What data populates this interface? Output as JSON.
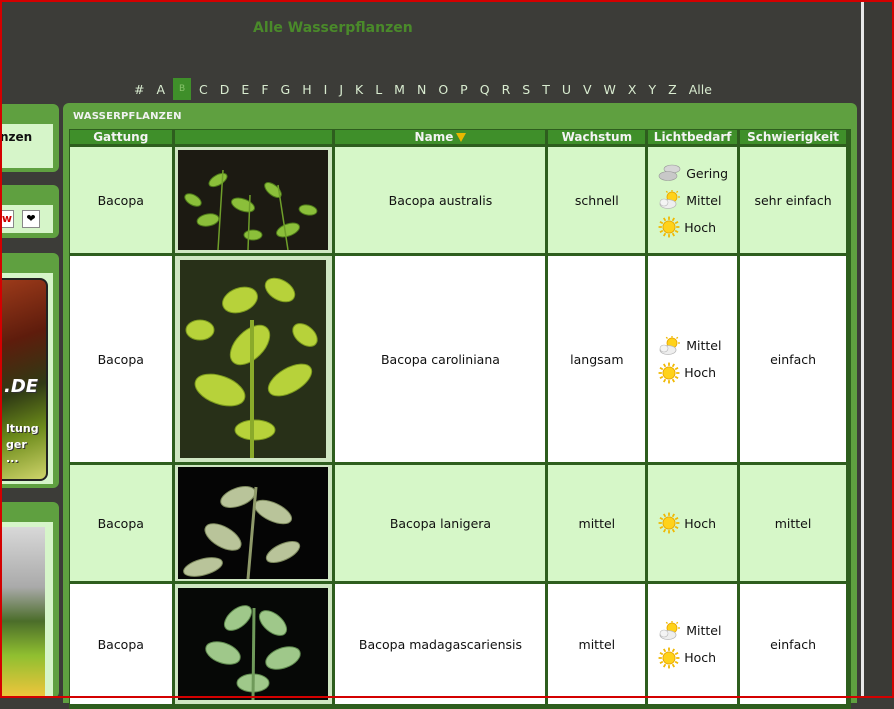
{
  "page": {
    "title": "Alle Wasserpflanzen"
  },
  "alphabet": {
    "letters": [
      "#",
      "A",
      "B",
      "C",
      "D",
      "E",
      "F",
      "G",
      "H",
      "I",
      "J",
      "K",
      "L",
      "M",
      "N",
      "O",
      "P",
      "Q",
      "R",
      "S",
      "T",
      "U",
      "V",
      "W",
      "X",
      "Y",
      "Z",
      "Alle"
    ],
    "active": "B"
  },
  "sidebar": {
    "box1_text": "nzen",
    "banner": {
      "line_de": ".DE",
      "line1": "ltung",
      "line2": "ger",
      "line3": "..."
    }
  },
  "panel": {
    "title": "WASSERPFLANZEN"
  },
  "table": {
    "headers": {
      "genus": "Gattung",
      "image": "",
      "name": "Name",
      "growth": "Wachstum",
      "light": "Lichtbedarf",
      "difficulty": "Schwierigkeit"
    },
    "rows": [
      {
        "genus": "Bacopa",
        "name": "Bacopa australis",
        "growth": "schnell",
        "light": [
          "Gering",
          "Mittel",
          "Hoch"
        ],
        "difficulty": "sehr einfach"
      },
      {
        "genus": "Bacopa",
        "name": "Bacopa caroliniana",
        "growth": "langsam",
        "light": [
          "Mittel",
          "Hoch"
        ],
        "difficulty": "einfach"
      },
      {
        "genus": "Bacopa",
        "name": "Bacopa lanigera",
        "growth": "mittel",
        "light": [
          "Hoch"
        ],
        "difficulty": "mittel"
      },
      {
        "genus": "Bacopa",
        "name": "Bacopa madagascariensis",
        "growth": "mittel",
        "light": [
          "Mittel",
          "Hoch"
        ],
        "difficulty": "einfach"
      }
    ]
  },
  "colors": {
    "accent": "#3f8f2a",
    "row_green": "#d6f7c8",
    "row_white": "#ffffff",
    "title": "#4a8a2a",
    "sort_arrow": "#e8b800"
  }
}
